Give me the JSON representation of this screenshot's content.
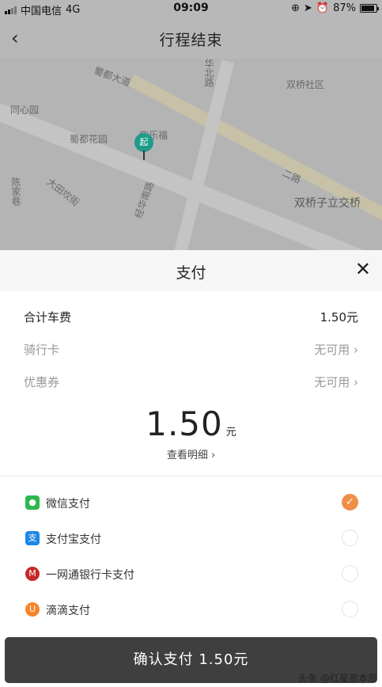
{
  "status_bar": {
    "carrier": "中国电信",
    "network": "4G",
    "time": "09:09",
    "battery": "87%"
  },
  "nav": {
    "back_icon": "chevron-left-icon",
    "title": "行程结束"
  },
  "map": {
    "pin_label": "起",
    "labels": [
      "蜀都大道",
      "华北路",
      "双桥社区",
      "同心园",
      "紫乐福",
      "蜀都花园",
      "陈家巷",
      "大田坎街",
      "经华南路",
      "双桥子立交桥",
      "二路"
    ]
  },
  "sheet": {
    "title": "支付",
    "close_icon": "close-icon",
    "rows": [
      {
        "key": "合计车费",
        "value": "1.50元"
      },
      {
        "key": "骑行卡",
        "value": "无可用 ›"
      },
      {
        "key": "优惠券",
        "value": "无可用 ›"
      }
    ],
    "amount": "1.50",
    "unit": "元",
    "detail_link": "查看明细 ›",
    "payment_methods": [
      {
        "name": "微信支付",
        "icon": "wechat-pay-icon",
        "color": "#2db84d",
        "selected": true
      },
      {
        "name": "支付宝支付",
        "icon": "alipay-icon",
        "color": "#1e88e5",
        "selected": false
      },
      {
        "name": "一网通银行卡支付",
        "icon": "cmb-bank-icon",
        "color": "#c62828",
        "selected": false
      },
      {
        "name": "滴滴支付",
        "icon": "didi-pay-icon",
        "color": "#f5842b",
        "selected": false
      }
    ],
    "confirm_button": "确认支付 1.50元"
  },
  "watermark": "头条 @红星资本局",
  "colors": {
    "accent": "#f08f48",
    "button": "#3f3f3f"
  }
}
